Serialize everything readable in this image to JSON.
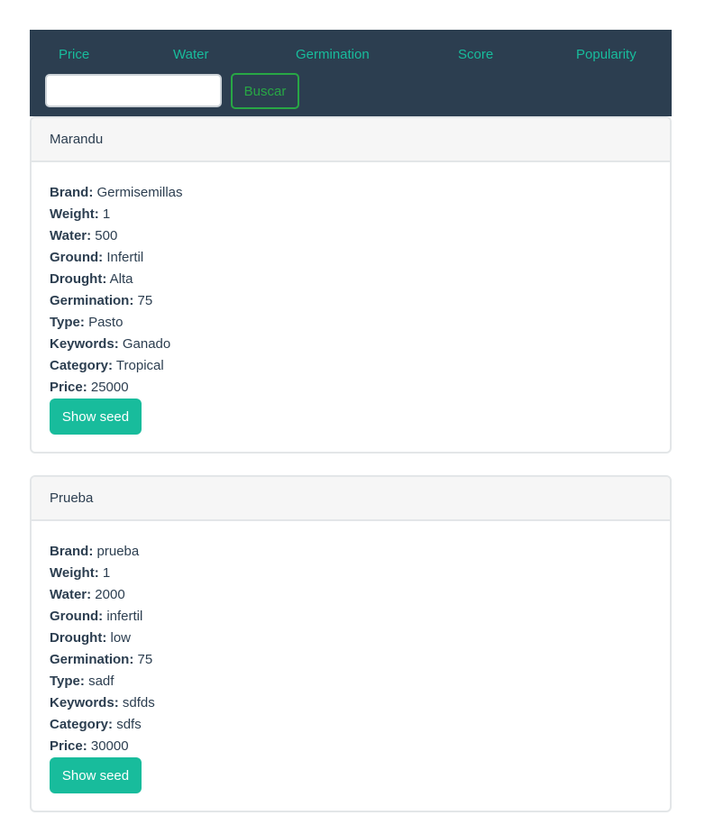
{
  "nav": {
    "links": [
      {
        "label": "Price"
      },
      {
        "label": "Water"
      },
      {
        "label": "Germination"
      },
      {
        "label": "Score"
      },
      {
        "label": "Popularity"
      }
    ],
    "search": {
      "placeholder": "",
      "value": ""
    },
    "search_button_label": "Buscar"
  },
  "labels": {
    "brand": "Brand:",
    "weight": "Weight:",
    "water": "Water:",
    "ground": "Ground:",
    "drought": "Drought:",
    "germination": "Germination:",
    "type": "Type:",
    "keywords": "Keywords:",
    "category": "Category:",
    "price": "Price:"
  },
  "seeds": [
    {
      "name": "Marandu",
      "brand": "Germisemillas",
      "weight": "1",
      "water": "500",
      "ground": "Infertil",
      "drought": "Alta",
      "germination": "75",
      "type": "Pasto",
      "keywords": "Ganado",
      "category": "Tropical",
      "price": "25000",
      "button_label": "Show seed"
    },
    {
      "name": "Prueba",
      "brand": "prueba",
      "weight": "1",
      "water": "2000",
      "ground": "infertil",
      "drought": "low",
      "germination": "75",
      "type": "sadf",
      "keywords": "sdfds",
      "category": "sdfs",
      "price": "30000",
      "button_label": "Show seed"
    }
  ],
  "colors": {
    "nav_bg": "#2c3e50",
    "accent": "#18bc9c",
    "search_button": "#28a745"
  }
}
